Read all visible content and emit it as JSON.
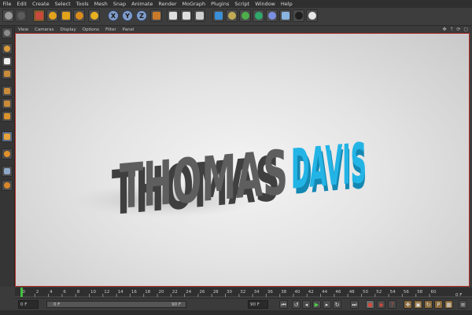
{
  "menubar": {
    "items": [
      "File",
      "Edit",
      "Create",
      "Select",
      "Tools",
      "Mesh",
      "Snap",
      "Animate",
      "Render",
      "MoGraph",
      "Plugins",
      "Script",
      "Window",
      "Help"
    ]
  },
  "toolbar": {
    "axis_x": "X",
    "axis_y": "Y",
    "axis_z": "Z"
  },
  "viewport_menu": {
    "items": [
      "View",
      "Cameras",
      "Display",
      "Options",
      "Filter",
      "Panel"
    ],
    "controls": "✥ ⇡ ⟳ ▢"
  },
  "scene": {
    "word1": "THOMAS",
    "word2": "DAVIS",
    "word1_color": "#5e5e5e",
    "word2_color": "#23b4e6"
  },
  "timeline": {
    "ticks": [
      "0",
      "2",
      "4",
      "6",
      "8",
      "10",
      "12",
      "14",
      "16",
      "18",
      "20",
      "22",
      "24",
      "26",
      "28",
      "30",
      "32",
      "34",
      "36",
      "38",
      "40",
      "42",
      "44",
      "46",
      "48",
      "50",
      "52",
      "54",
      "56",
      "58",
      "60"
    ],
    "current_frame": "0 F",
    "end_label": "0 F"
  },
  "transport": {
    "start_field": "0 F",
    "range_start": "0 F",
    "range_end": "90 F",
    "end_field": "90 F"
  },
  "colors": {
    "accent": "#b1302a",
    "ui_bg": "#3b3b3b"
  }
}
